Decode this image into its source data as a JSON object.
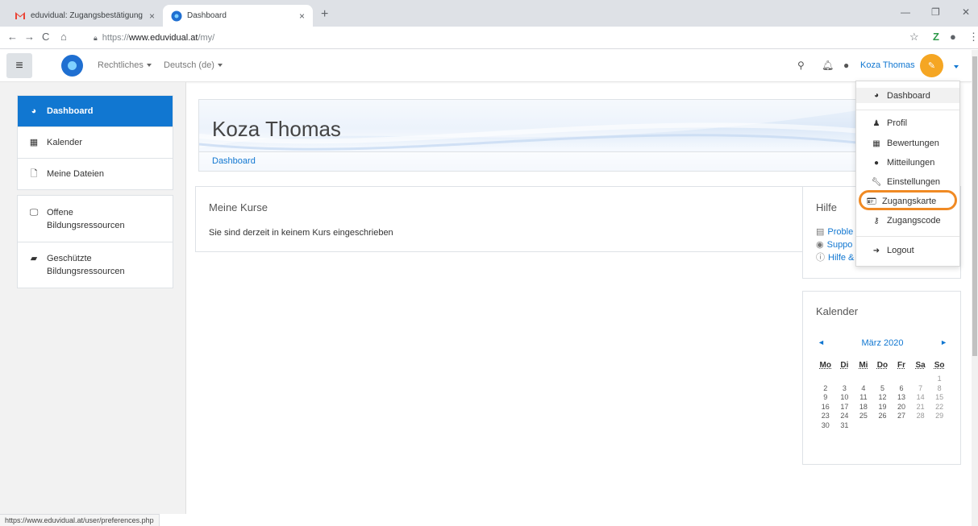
{
  "browser": {
    "tabs": [
      {
        "title": "eduvidual: Zugangsbestätigung",
        "close": "×",
        "icon": "gmail-icon"
      },
      {
        "title": "Dashboard",
        "close": "×",
        "icon": "site-icon"
      }
    ],
    "new_tab": "+",
    "url_scheme": "https://",
    "url_host": "www.eduvidual.at",
    "url_path": "/my/",
    "status_url": "https://www.eduvidual.at/user/preferences.php"
  },
  "navbar": {
    "links": [
      {
        "label": "Rechtliches"
      },
      {
        "label": "Deutsch (de)"
      }
    ],
    "username": "Koza Thomas"
  },
  "drawer": {
    "group1": [
      {
        "label": "Dashboard",
        "icon": "dashboard-icon"
      },
      {
        "label": "Kalender",
        "icon": "calendar-icon"
      },
      {
        "label": "Meine Dateien",
        "icon": "file-icon"
      }
    ],
    "group2": [
      {
        "label": "Offene Bildungsressourcen",
        "icon": "desktop-icon"
      },
      {
        "label": "Geschützte Bildungsressourcen",
        "icon": "book-icon"
      }
    ]
  },
  "header": {
    "title": "Koza Thomas",
    "breadcrumb": "Dashboard"
  },
  "courses": {
    "title": "Meine Kurse",
    "empty_message": "Sie sind derzeit in keinem Kurs eingeschrieben"
  },
  "help": {
    "title": "Hilfe",
    "links": [
      "Proble",
      "Suppo",
      "Hilfe &"
    ]
  },
  "calendar": {
    "title": "Kalender",
    "month": "März 2020",
    "prev": "◄",
    "next": "►",
    "weekdays": [
      "Mo",
      "Di",
      "Mi",
      "Do",
      "Fr",
      "Sa",
      "So"
    ],
    "weeks": [
      [
        "",
        "",
        "",
        "",
        "",
        "",
        "1"
      ],
      [
        "2",
        "3",
        "4",
        "5",
        "6",
        "7",
        "8"
      ],
      [
        "9",
        "10",
        "11",
        "12",
        "13",
        "14",
        "15"
      ],
      [
        "16",
        "17",
        "18",
        "19",
        "20",
        "21",
        "22"
      ],
      [
        "23",
        "24",
        "25",
        "26",
        "27",
        "28",
        "29"
      ],
      [
        "30",
        "31",
        "",
        "",
        "",
        "",
        ""
      ]
    ]
  },
  "user_menu": {
    "items": [
      {
        "label": "Dashboard",
        "icon": "dashboard-icon"
      },
      {
        "label": "Profil",
        "icon": "user-icon"
      },
      {
        "label": "Bewertungen",
        "icon": "table-icon"
      },
      {
        "label": "Mitteilungen",
        "icon": "chat-icon"
      },
      {
        "label": "Einstellungen",
        "icon": "wrench-icon"
      },
      {
        "label": "Zugangskarte",
        "icon": "id-card-icon"
      },
      {
        "label": "Zugangscode",
        "icon": "key-icon"
      },
      {
        "label": "Logout",
        "icon": "logout-icon"
      }
    ],
    "highlight_color": "#f08a24"
  },
  "colors": {
    "accent": "#1177d1",
    "avatar": "#f5a623"
  }
}
